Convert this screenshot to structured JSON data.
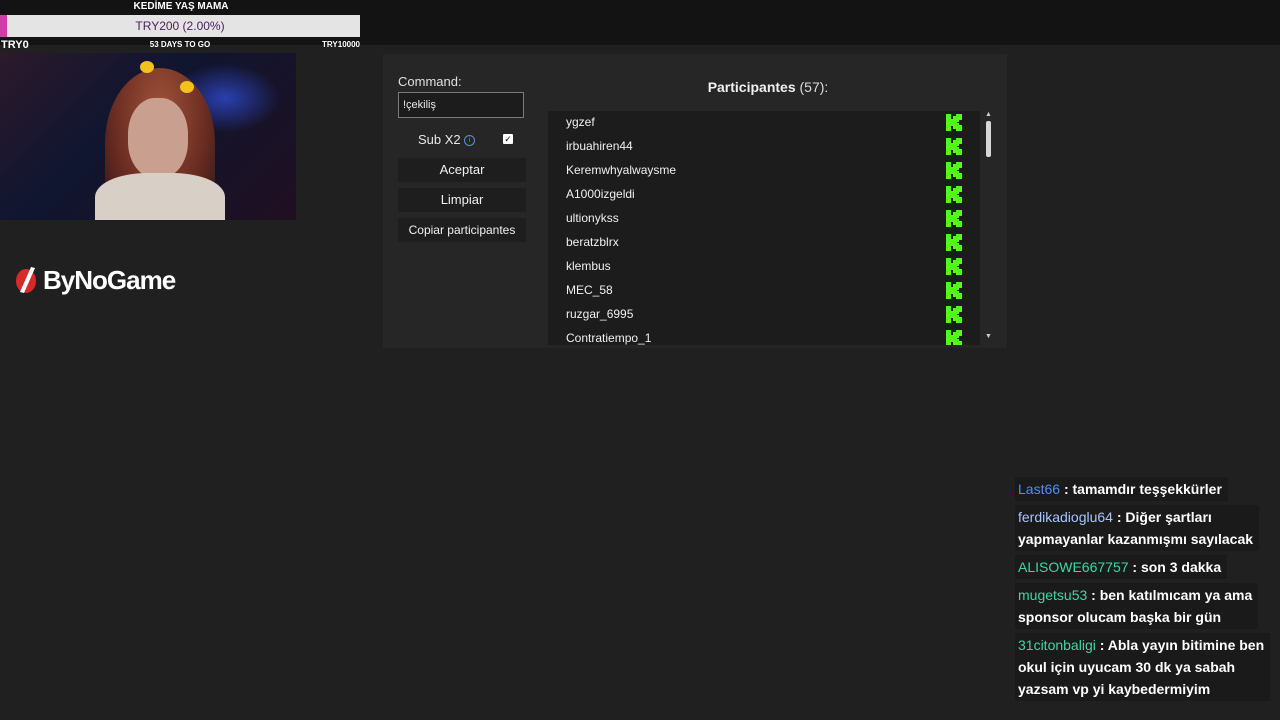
{
  "goal": {
    "title": "KEDİME YAŞ MAMA",
    "amount": "TRY200 (2.00%)",
    "progress": 0.02,
    "start": "TRY0",
    "days_left": "53 DAYS TO GO",
    "target": "TRY10000",
    "fill_color": "#d63aa6"
  },
  "logo": {
    "text": "ByNoGame"
  },
  "giveaway": {
    "command_label": "Command:",
    "command_value": "!çekiliş",
    "sub_label": "Sub X2",
    "sub_checked": true,
    "accept_label": "Aceptar",
    "clear_label": "Limpiar",
    "copy_label": "Copiar participantes",
    "participants_label": "Participantes",
    "participants_count": "(57):",
    "participants": [
      "ygzef",
      "irbuahiren44",
      "Keremwhyalwaysme",
      "A1000izgeldi",
      "ultionykss",
      "beratzblrx",
      "klembus",
      "MEC_58",
      "ruzgar_6995",
      "Contratiempo_1"
    ],
    "platform_icon": "kick-icon",
    "platform_color": "#53fc18"
  },
  "chat": [
    {
      "user": "Last66",
      "color": "#4f8ff0",
      "lines": [
        ": tamamdır teşşekkürler"
      ]
    },
    {
      "user": "ferdikadioglu64",
      "color": "#a9c5ff",
      "lines": [
        ": Diğer şartları",
        "yapmayanlar kazanmışmı sayılacak"
      ]
    },
    {
      "user": "ALISOWE667757",
      "color": "#3fd6a6",
      "lines": [
        ": son 3 dakka"
      ]
    },
    {
      "user": "mugetsu53",
      "color": "#3fd6a6",
      "lines": [
        ": ben katılmıcam ya ama",
        "sponsor olucam başka bir gün"
      ]
    },
    {
      "user": "31citonbaligi",
      "color": "#3fd6a6",
      "lines": [
        ": Abla yayın bitimine ben",
        "okul için uyucam 30 dk ya sabah",
        "yazsam vp yi kaybedermiyim"
      ]
    }
  ]
}
